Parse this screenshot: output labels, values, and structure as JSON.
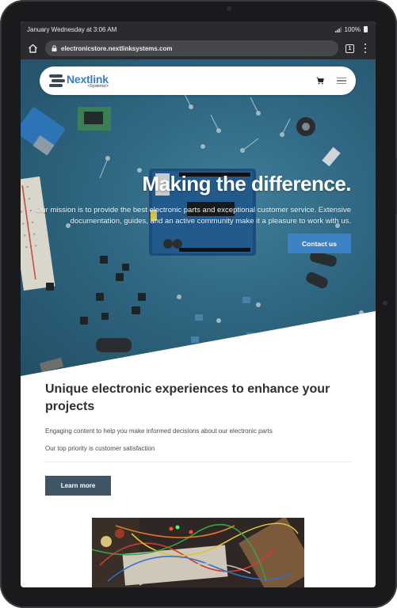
{
  "status_bar": {
    "time_text": "January Wednesday at 3:06 AM",
    "signal": "signal-icon",
    "battery_text": "100%"
  },
  "browser": {
    "url": "electronicstore.nextlinksystems.com",
    "tab_count": "1",
    "icons": [
      "home-icon",
      "lock-icon",
      "tabs-icon",
      "more-icon"
    ]
  },
  "nav": {
    "logo_name": "Nextlink",
    "logo_sub": "<Systems/>",
    "icons": [
      "cart-icon",
      "menu-icon"
    ]
  },
  "hero": {
    "title": "Making the difference.",
    "description": "Our mission is to provide the best electronic parts and exceptional customer service. Extensive documentation, guides, and an active community make it a pleasure to work with us.",
    "cta_label": "Contact us"
  },
  "content": {
    "title": "Unique electronic experiences to enhance your projects",
    "paragraph_1": "Engaging content to help you make informed decisions about our electronic parts",
    "paragraph_2": "Our top priority is customer satisfaction",
    "button_label": "Learn more"
  },
  "colors": {
    "accent": "#3d82c4",
    "hero_bg": "#2f6681",
    "dark_button": "#3f5563",
    "browser_chrome": "#2a2b2f"
  }
}
